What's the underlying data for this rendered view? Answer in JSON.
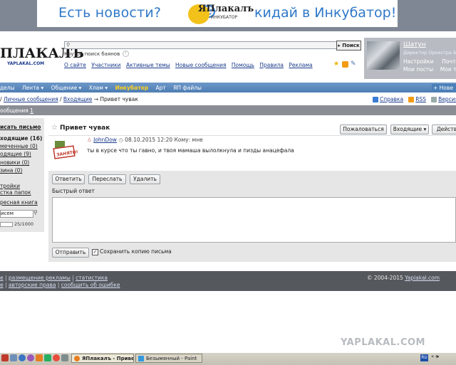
{
  "banner": {
    "text_left": "Есть новости?",
    "logo_text": "ЯПлакалъ",
    "logo_sub": "ИНКУБАТОР",
    "text_right": "кидай в Инкубатор!"
  },
  "header": {
    "logo": "ПЛАКАЛЪ",
    "logo_sub": "YAPLAKAL.COM",
    "search_placeholder": "",
    "search_button": "Поиск",
    "search_hint": "Крутой поиск баянов",
    "top_links": [
      "О сайте",
      "Участники",
      "Активные темы",
      "Новые сообщения",
      "Помощь",
      "Правила",
      "Реклама"
    ]
  },
  "user": {
    "name": "Шатун",
    "role": "Директор Оркестра Бале",
    "links_row1": [
      "Настройки",
      "Почта"
    ],
    "links_row2": [
      "Мои посты",
      "Мои те"
    ]
  },
  "nav": {
    "items": [
      "делы",
      "Лента ▾",
      "Общение ▾",
      "Хлам ▾",
      "Инкубатор",
      "Арт",
      "ЯП файлы"
    ],
    "highlight_index": 4,
    "new_label": "Нове"
  },
  "breadcrumb": {
    "prefix": "/",
    "items": [
      "Личные сообщения",
      "Входящие"
    ],
    "current": "→ Привет чувак"
  },
  "right_links": [
    "Справка",
    "RSS",
    "Версия дл"
  ],
  "section": {
    "title": "ообщения",
    "page": "1"
  },
  "sidebar": {
    "write": "исать письмо",
    "folders": [
      "ходящие (16)",
      "меченные (0)",
      "одящие (9)",
      "новики (0)",
      "зина (0)"
    ],
    "links": [
      "тройки",
      "стка папок"
    ],
    "address_book": "ресная книга",
    "search_value": "исем",
    "quota": "25/1000"
  },
  "message": {
    "title": "Привет чувак",
    "complain_button": "Пожаловаться",
    "inbox_button": "Входящие ▾",
    "actions_button": "Действ",
    "author": "JohnDow",
    "datetime": "08.10.2015 12:20",
    "to_label": "Кому: мне",
    "body": "ты в курсе что ты гавно, и твоя мамаша вылолкнула и пизды анацефала",
    "avatar_stamp": "ЗАНЯТО!"
  },
  "reply": {
    "reply_button": "Ответить",
    "forward_button": "Переслать",
    "delete_button": "Удалить",
    "quick_label": "Быстрый ответ",
    "send_button": "Отправить",
    "keep_copy_label": "Сохранить копию письма",
    "keep_copy_checked": true
  },
  "footer": {
    "line1": [
      "е",
      "размещение рекламы",
      "статистика"
    ],
    "line2": [
      "е",
      "авторские права",
      "сообщить об ошибке"
    ],
    "copyright_prefix": "© 2004-2015",
    "copyright_link": "Yaplakal.com"
  },
  "watermark": "YAPLAKAL.COM",
  "taskbar": {
    "task1": "ЯПлакалъ - Привет ч...",
    "task2": "Безымянный - Paint",
    "lang": "RU",
    "tray": "« 🕪"
  },
  "colors": {
    "banner_text": "#2f78c9",
    "nav_bar": "#5b88be",
    "nav_highlight": "#ffd21f",
    "section_bar": "#8a8e94",
    "footer": "#55585d",
    "link": "#1a3a8c"
  }
}
